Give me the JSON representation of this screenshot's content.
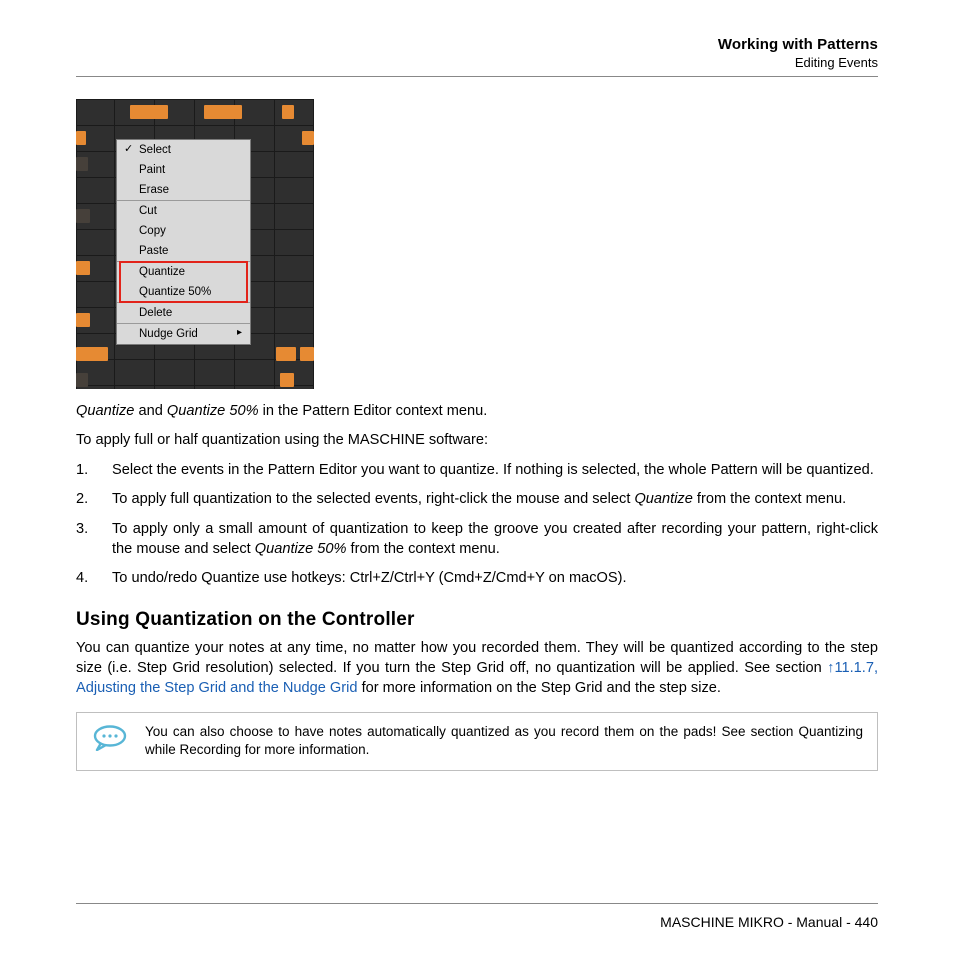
{
  "header": {
    "title": "Working with Patterns",
    "sub": "Editing Events"
  },
  "menu": {
    "select": "Select",
    "paint": "Paint",
    "erase": "Erase",
    "cut": "Cut",
    "copy": "Copy",
    "paste": "Paste",
    "quantize": "Quantize",
    "quantize50": "Quantize 50%",
    "delete": "Delete",
    "nudge_grid": "Nudge Grid"
  },
  "caption": {
    "q": "Quantize",
    "and": " and ",
    "q50": "Quantize 50%",
    "rest": " in the Pattern Editor context menu."
  },
  "intro": "To apply full or half quantization using the MASCHINE software:",
  "steps": {
    "s1": "Select the events in the Pattern Editor you want to quantize. If nothing is selected, the whole Pattern will be quantized.",
    "s2a": "To apply full quantization to the selected events, right-click the mouse and select ",
    "s2b": "Quantize",
    "s2c": " from the context menu.",
    "s3a": "To apply only a small amount of quantization to keep the groove you created after recording your pattern, right-click the mouse and select ",
    "s3b": "Quantize 50%",
    "s3c": " from the context menu.",
    "s4": "To undo/redo Quantize use hotkeys: Ctrl+Z/Ctrl+Y (Cmd+Z/Cmd+Y on macOS)."
  },
  "subhead": "Using Quantization on the Controller",
  "para": {
    "a": "You can quantize your notes at any time, no matter how you recorded them. They will be quantized according to the step size (i.e. Step Grid resolution) selected. If you turn the Step Grid off, no quantization will be applied. See section ",
    "link": "↑11.1.7, Adjusting the Step Grid and the Nudge Grid",
    "b": " for more information on the Step Grid and the step size."
  },
  "note": "You can also choose to have notes automatically quantized as you record them on the pads! See section Quantizing while Recording for more information.",
  "footer": "MASCHINE MIKRO - Manual - 440"
}
